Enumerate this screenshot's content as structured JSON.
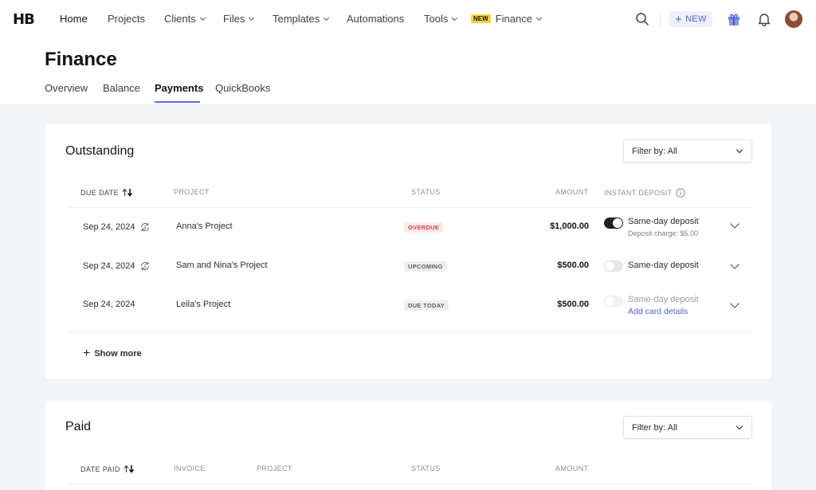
{
  "brand": {
    "logo_text": "HB"
  },
  "nav": {
    "items": [
      {
        "label": "Home",
        "dropdown": false
      },
      {
        "label": "Projects",
        "dropdown": false
      },
      {
        "label": "Clients",
        "dropdown": true
      },
      {
        "label": "Files",
        "dropdown": true
      },
      {
        "label": "Templates",
        "dropdown": true
      },
      {
        "label": "Automations",
        "dropdown": false
      },
      {
        "label": "Tools",
        "dropdown": true
      },
      {
        "label": "Finance",
        "dropdown": true,
        "tag": "NEW"
      }
    ],
    "new_button_label": "NEW",
    "icons": [
      "search-icon",
      "plus-icon",
      "gift-icon",
      "bell-icon",
      "avatar"
    ]
  },
  "page": {
    "title": "Finance",
    "tabs": [
      "Overview",
      "Balance",
      "Payments",
      "QuickBooks"
    ],
    "active_tab": "Payments"
  },
  "outstanding": {
    "title": "Outstanding",
    "filter_label": "Filter by: All",
    "columns": {
      "due_date": "DUE DATE",
      "project": "PROJECT",
      "status": "STATUS",
      "amount": "AMOUNT",
      "instant_deposit": "INSTANT DEPOSIT"
    },
    "rows": [
      {
        "date": "Sep 24, 2024",
        "recurring": true,
        "project": "Anna's Project",
        "status": "OVERDUE",
        "amount": "$1,000.00",
        "deposit_label": "Same-day deposit",
        "deposit_on": true,
        "deposit_sub": "Deposit charge: $5.00"
      },
      {
        "date": "Sep 24, 2024",
        "recurring": true,
        "project": "Sam and Nina's Project",
        "status": "UPCOMING",
        "amount": "$500.00",
        "deposit_label": "Same-day deposit",
        "deposit_on": false
      },
      {
        "date": "Sep 24, 2024",
        "recurring": false,
        "project": "Leila's Project",
        "status": "DUE TODAY",
        "amount": "$500.00",
        "deposit_label": "Same-day deposit",
        "deposit_on": false,
        "deposit_disabled": true,
        "deposit_link": "Add card details"
      }
    ],
    "show_more_label": "Show more"
  },
  "paid": {
    "title": "Paid",
    "filter_label": "Filter by: All",
    "columns": {
      "date_paid": "DATE PAID",
      "invoice": "INVOICE",
      "project": "PROJECT",
      "status": "STATUS",
      "amount": "AMOUNT"
    }
  }
}
